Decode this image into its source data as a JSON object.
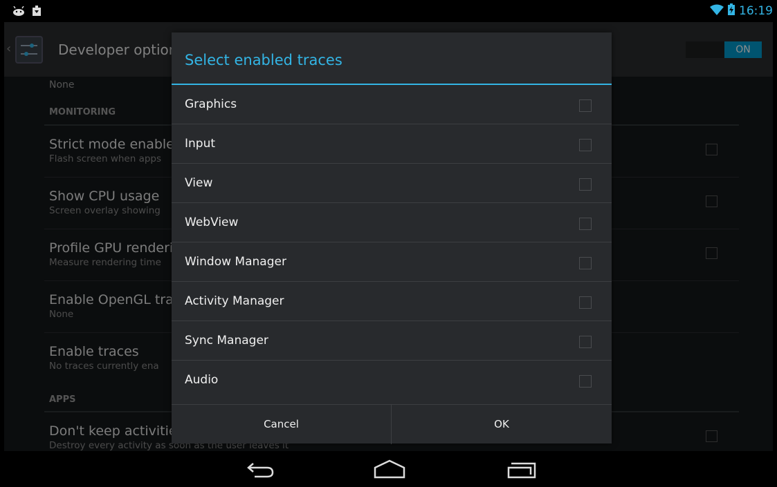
{
  "status_bar": {
    "time": "16:19",
    "left_icons": [
      "android-debug-icon",
      "download-icon"
    ],
    "right_icons": [
      "wifi-icon",
      "battery-icon"
    ]
  },
  "action_bar": {
    "title": "Developer options",
    "switch_label": "ON"
  },
  "settings": {
    "top_summary": "None",
    "monitoring_header": "MONITORING",
    "prefs": [
      {
        "title": "Strict mode enable",
        "summary": "Flash screen when apps"
      },
      {
        "title": "Show CPU usage",
        "summary": "Screen overlay showing"
      },
      {
        "title": "Profile GPU renderi",
        "summary": "Measure rendering time"
      },
      {
        "title": "Enable OpenGL tra",
        "summary": "None"
      },
      {
        "title": "Enable traces",
        "summary": "No traces currently ena"
      }
    ],
    "apps_header": "APPS",
    "last_pref": {
      "title": "Don't keep activitie",
      "summary": "Destroy every activity as soon as the user leaves it"
    }
  },
  "dialog": {
    "title": "Select enabled traces",
    "items": [
      {
        "label": "Graphics",
        "checked": false
      },
      {
        "label": "Input",
        "checked": false
      },
      {
        "label": "View",
        "checked": false
      },
      {
        "label": "WebView",
        "checked": false
      },
      {
        "label": "Window Manager",
        "checked": false
      },
      {
        "label": "Activity Manager",
        "checked": false
      },
      {
        "label": "Sync Manager",
        "checked": false
      },
      {
        "label": "Audio",
        "checked": false
      }
    ],
    "cancel_label": "Cancel",
    "ok_label": "OK"
  },
  "nav_bar": {
    "icons": [
      "back-icon",
      "home-icon",
      "recents-icon"
    ]
  },
  "colors": {
    "accent": "#33b5e5",
    "switch_on": "#0099cc"
  }
}
